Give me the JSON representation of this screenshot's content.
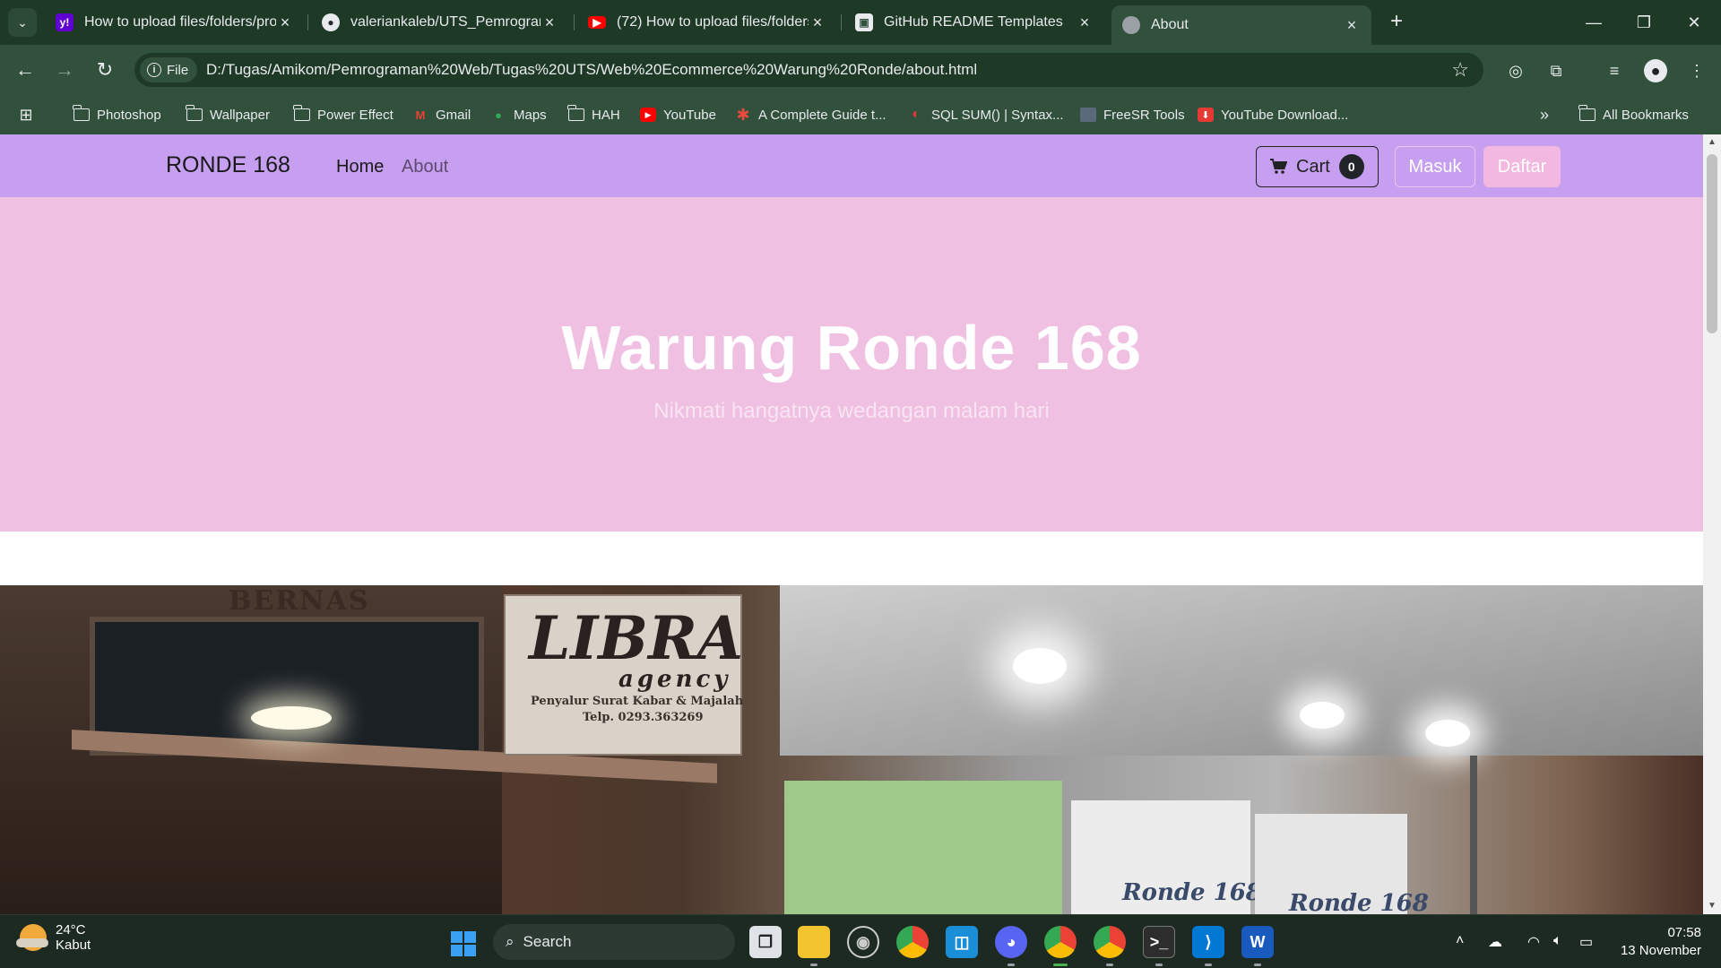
{
  "browser": {
    "tabs": [
      {
        "title": "How to upload files/folders/pro",
        "icon": "yahoo-icon",
        "color": "#6001d2"
      },
      {
        "title": "valeriankaleb/UTS_Pemrograma",
        "icon": "github-icon",
        "color": "#24292f"
      },
      {
        "title": "(72) How to upload files/folders",
        "icon": "youtube-icon",
        "color": "#ff0000"
      },
      {
        "title": "GitHub README Templates",
        "icon": "readme-icon",
        "color": "#e8eaed"
      },
      {
        "title": "About",
        "icon": "globe-icon",
        "color": "#9aa0a6",
        "active": true
      }
    ],
    "file_chip": "File",
    "url": "D:/Tugas/Amikom/Pemrograman%20Web/Tugas%20UTS/Web%20Ecommerce%20Warung%20Ronde/about.html",
    "bookmarks": [
      {
        "label": "Photoshop",
        "icon": "folder-icon"
      },
      {
        "label": "Wallpaper",
        "icon": "folder-icon"
      },
      {
        "label": "Power Effect",
        "icon": "folder-icon"
      },
      {
        "label": "Gmail",
        "icon": "gmail-icon"
      },
      {
        "label": "Maps",
        "icon": "maps-icon"
      },
      {
        "label": "HAH",
        "icon": "folder-icon"
      },
      {
        "label": "YouTube",
        "icon": "youtube-icon"
      },
      {
        "label": "A Complete Guide t...",
        "icon": "asterisk-icon"
      },
      {
        "label": "SQL SUM() | Syntax...",
        "icon": "sql-icon"
      },
      {
        "label": "FreeSR Tools",
        "icon": "freesr-icon"
      },
      {
        "label": "YouTube Download...",
        "icon": "download-icon"
      }
    ],
    "all_bookmarks": "All Bookmarks"
  },
  "site": {
    "brand": "RONDE 168",
    "nav": [
      {
        "label": "Home",
        "active": true
      },
      {
        "label": "About",
        "active": false
      }
    ],
    "cart": {
      "label": "Cart",
      "count": "0"
    },
    "login": "Masuk",
    "register": "Daftar",
    "hero": {
      "title": "Warung Ronde 168",
      "subtitle": "Nikmati hangatnya wedangan malam hari"
    },
    "photo_signs": {
      "bernas": "BERNAS",
      "libra": "LIBRA",
      "agency": "agency",
      "libra_line1": "Penyalur Surat Kabar & Majalah",
      "libra_line2": "Telp. 0293.363269",
      "banner_a": "Ronde 168",
      "banner_b": "Ronde 168"
    },
    "colors": {
      "nav": "#c79ff0",
      "hero": "#efc0e2",
      "daftar": "#f2b8df"
    }
  },
  "taskbar": {
    "weather_temp": "24°C",
    "weather_desc": "Kabut",
    "search": "Search",
    "time": "07:58",
    "date": "13 November"
  }
}
